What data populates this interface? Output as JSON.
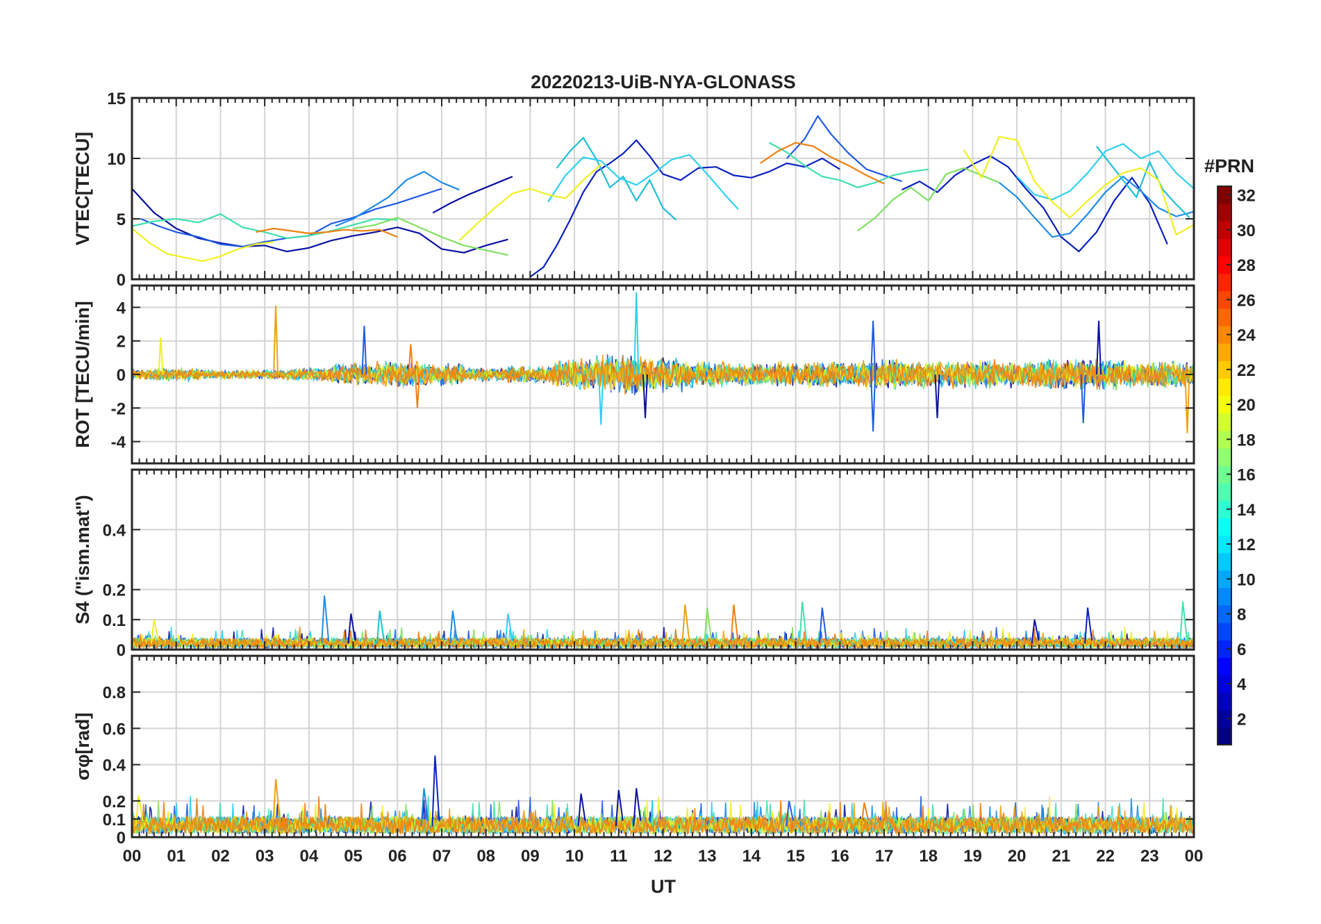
{
  "chart_data": {
    "type": "line",
    "title": "20220213-UiB-NYA-GLONASS",
    "xlabel": "UT",
    "x_ticks": [
      "00",
      "01",
      "02",
      "03",
      "04",
      "05",
      "06",
      "07",
      "08",
      "09",
      "10",
      "11",
      "12",
      "13",
      "14",
      "15",
      "16",
      "17",
      "18",
      "19",
      "20",
      "21",
      "22",
      "23",
      "00"
    ],
    "xlim": [
      0,
      24
    ],
    "grid": true,
    "colorbar": {
      "label": "#PRN",
      "colormap": "jet",
      "range": [
        1,
        32
      ],
      "ticks": [
        2,
        4,
        6,
        8,
        10,
        12,
        14,
        16,
        18,
        20,
        22,
        24,
        26,
        28,
        30,
        32
      ]
    },
    "panels": [
      {
        "id": "vtec",
        "ylabel": "VTEC[TECU]",
        "ylim": [
          0,
          15
        ],
        "y_ticks": [
          0,
          5,
          10,
          15
        ],
        "series": [
          {
            "color": "#0a10a0",
            "x": [
              0,
              0.5,
              1,
              1.5,
              2,
              2.5,
              3,
              3.5,
              4,
              4.5,
              5,
              5.5,
              6,
              6.5,
              7,
              7.5,
              8,
              8.5
            ],
            "y": [
              7.5,
              5.5,
              4.2,
              3.4,
              3.0,
              2.7,
              2.8,
              2.3,
              2.6,
              3.2,
              3.6,
              3.9,
              4.3,
              3.8,
              2.5,
              2.2,
              2.8,
              3.3
            ]
          },
          {
            "color": "#0a10a0",
            "x": [
              6.8,
              7.2,
              7.6,
              8.0,
              8.4,
              8.6
            ],
            "y": [
              5.5,
              6.3,
              7.0,
              7.6,
              8.2,
              8.5
            ]
          },
          {
            "color": "#0a20c0",
            "x": [
              9.0,
              9.3,
              9.6,
              9.9,
              10.2,
              10.5,
              10.8,
              11.1,
              11.4,
              11.7,
              12.0,
              12.4,
              12.8,
              13.2,
              13.6,
              14.0,
              14.4,
              14.8,
              15.2,
              15.6,
              16.0
            ],
            "y": [
              0.2,
              1.0,
              2.8,
              4.9,
              7.2,
              8.9,
              9.6,
              10.4,
              11.5,
              10.2,
              8.7,
              8.2,
              9.2,
              9.3,
              8.6,
              8.4,
              8.9,
              9.6,
              9.3,
              10.0,
              9.1
            ]
          },
          {
            "color": "#0a20c0",
            "x": [
              17.4,
              17.8,
              18.2,
              18.6,
              19.0,
              19.4,
              19.8,
              20.2,
              20.6,
              21.0,
              21.4,
              21.8,
              22.2,
              22.6,
              23.0,
              23.4
            ],
            "y": [
              7.4,
              8.1,
              7.2,
              8.6,
              9.5,
              10.2,
              9.3,
              7.5,
              5.9,
              3.5,
              2.3,
              3.9,
              6.5,
              8.4,
              6.3,
              2.9
            ]
          },
          {
            "color": "#1e5ae6",
            "x": [
              0.2,
              0.6,
              1.0,
              1.5,
              2.0,
              2.5,
              3.0,
              3.5,
              4.0,
              4.5,
              5.0,
              5.5,
              6.0,
              6.5,
              7.0
            ],
            "y": [
              5.0,
              4.4,
              3.9,
              3.5,
              2.9,
              2.7,
              3.1,
              3.4,
              3.6,
              4.6,
              5.1,
              5.8,
              6.3,
              6.9,
              7.5
            ]
          },
          {
            "color": "#1e5ae6",
            "x": [
              14.8,
              15.2,
              15.5,
              15.8,
              16.2,
              16.6,
              17.0,
              17.4
            ],
            "y": [
              10.0,
              11.6,
              13.5,
              12.0,
              10.4,
              9.1,
              8.6,
              8.1
            ]
          },
          {
            "color": "#1e8ce6",
            "x": [
              4.6,
              5.0,
              5.4,
              5.8,
              6.2,
              6.6,
              7.0,
              7.4
            ],
            "y": [
              4.4,
              5.0,
              5.9,
              6.8,
              8.2,
              8.9,
              8.0,
              7.4
            ]
          },
          {
            "color": "#1e8ce6",
            "x": [
              19.6,
              20.0,
              20.4,
              20.8,
              21.2,
              21.6,
              22.0,
              22.4,
              22.8,
              23.2,
              23.6,
              24.0
            ],
            "y": [
              8.0,
              6.8,
              5.1,
              3.5,
              3.8,
              5.4,
              7.2,
              8.5,
              7.3,
              5.9,
              5.2,
              5.6
            ]
          },
          {
            "color": "#1ebed6",
            "x": [
              9.6,
              9.9,
              10.2,
              10.5,
              10.8,
              11.1,
              11.4,
              11.7,
              12.0,
              12.3
            ],
            "y": [
              9.2,
              10.6,
              11.7,
              9.9,
              7.6,
              8.5,
              6.5,
              8.2,
              5.9,
              4.9
            ]
          },
          {
            "color": "#1ebed6",
            "x": [
              21.8,
              22.1,
              22.4,
              22.7,
              23.0,
              23.3,
              23.6,
              23.9
            ],
            "y": [
              11.0,
              9.6,
              8.2,
              6.8,
              9.7,
              7.4,
              6.2,
              5.1
            ]
          },
          {
            "color": "#2ed0f0",
            "x": [
              9.4,
              9.8,
              10.2,
              10.6,
              11.0,
              11.4,
              11.8,
              12.2,
              12.6,
              13.0,
              13.4,
              13.7
            ],
            "y": [
              6.4,
              8.6,
              10.1,
              9.8,
              8.4,
              7.8,
              8.8,
              9.9,
              10.3,
              8.7,
              7.0,
              5.8
            ]
          },
          {
            "color": "#2ed0f0",
            "x": [
              20.0,
              20.4,
              20.8,
              21.2,
              21.6,
              22.0,
              22.4,
              22.8,
              23.2,
              23.6,
              24.0
            ],
            "y": [
              8.5,
              7.0,
              6.6,
              7.3,
              8.8,
              10.6,
              11.2,
              10.0,
              10.6,
              8.8,
              7.5
            ]
          },
          {
            "color": "#40e0b0",
            "x": [
              0.0,
              0.5,
              1.0,
              1.5,
              2.0,
              2.5,
              3.0,
              3.5,
              4.0,
              4.5,
              5.0,
              5.5,
              6.0
            ],
            "y": [
              4.4,
              4.8,
              5.0,
              4.7,
              5.4,
              4.3,
              3.9,
              3.4,
              3.6,
              4.0,
              4.5,
              5.0,
              4.9
            ]
          },
          {
            "color": "#40e0b0",
            "x": [
              14.4,
              14.8,
              15.2,
              15.6,
              16.0,
              16.4,
              16.8,
              17.2,
              17.6,
              18.0
            ],
            "y": [
              11.3,
              10.5,
              9.4,
              8.5,
              8.2,
              7.6,
              8.0,
              8.6,
              8.9,
              9.1
            ]
          },
          {
            "color": "#80e060",
            "x": [
              5.0,
              5.5,
              6.0,
              6.5,
              7.0,
              7.5,
              8.0,
              8.5
            ],
            "y": [
              4.2,
              4.5,
              5.1,
              4.3,
              3.5,
              2.8,
              2.4,
              2.0
            ]
          },
          {
            "color": "#80e060",
            "x": [
              16.4,
              16.8,
              17.2,
              17.6,
              18.0,
              18.4,
              18.8,
              19.2,
              19.6
            ],
            "y": [
              4.0,
              5.1,
              6.6,
              7.6,
              6.5,
              8.7,
              9.2,
              8.6,
              8.0
            ]
          },
          {
            "color": "#f0f020",
            "x": [
              0.0,
              0.4,
              0.8,
              1.2,
              1.6,
              2.0,
              2.4,
              2.8,
              3.2
            ],
            "y": [
              4.2,
              3.0,
              2.1,
              1.8,
              1.5,
              1.9,
              2.5,
              2.9,
              3.1
            ]
          },
          {
            "color": "#f0f020",
            "x": [
              7.4,
              7.8,
              8.2,
              8.6,
              9.0,
              9.4,
              9.8,
              10.2,
              10.6
            ],
            "y": [
              3.2,
              4.6,
              5.9,
              7.1,
              7.5,
              7.0,
              6.7,
              8.2,
              9.5
            ]
          },
          {
            "color": "#f0f020",
            "x": [
              18.8,
              19.2,
              19.6,
              20.0,
              20.4,
              20.8,
              21.2,
              21.6,
              22.0,
              22.4,
              22.8,
              23.2,
              23.6,
              24.0
            ],
            "y": [
              10.7,
              8.4,
              11.8,
              11.5,
              8.1,
              6.4,
              5.1,
              6.5,
              7.8,
              8.8,
              9.2,
              8.2,
              3.7,
              4.5
            ]
          },
          {
            "color": "#f08010",
            "x": [
              2.8,
              3.2,
              3.6,
              4.0,
              4.4,
              4.8,
              5.2,
              5.6,
              6.0
            ],
            "y": [
              3.9,
              4.2,
              4.0,
              3.8,
              3.9,
              4.1,
              4.0,
              4.1,
              3.5
            ]
          },
          {
            "color": "#f08010",
            "x": [
              14.2,
              14.6,
              15.0,
              15.4,
              15.8,
              16.2,
              16.6,
              17.0
            ],
            "y": [
              9.6,
              10.6,
              11.3,
              11.0,
              10.1,
              9.4,
              8.6,
              7.9
            ]
          }
        ]
      },
      {
        "id": "rot",
        "ylabel": "ROT [TECU/min]",
        "ylim": [
          -5.3,
          5.3
        ],
        "y_ticks": [
          -4,
          -2,
          0,
          2,
          4
        ],
        "noise": {
          "amplitude_by_hour": [
            0.25,
            0.3,
            0.2,
            0.2,
            0.3,
            0.5,
            0.6,
            0.5,
            0.3,
            0.4,
            0.7,
            1.0,
            0.8,
            0.6,
            0.5,
            0.6,
            0.6,
            0.7,
            0.6,
            0.7,
            0.6,
            0.7,
            0.7,
            0.6,
            0.6
          ]
        },
        "spikes": [
          {
            "x": 0.65,
            "y": 2.2,
            "color": "#f0f020"
          },
          {
            "x": 3.25,
            "y": 4.1,
            "color": "#f0a010"
          },
          {
            "x": 5.25,
            "y": 2.9,
            "color": "#1e5ae6"
          },
          {
            "x": 6.3,
            "y": 1.8,
            "color": "#f08010"
          },
          {
            "x": 6.45,
            "y": -2.0,
            "color": "#f08010"
          },
          {
            "x": 10.6,
            "y": -3.0,
            "color": "#2ed0f0"
          },
          {
            "x": 11.4,
            "y": 4.9,
            "color": "#2ed0f0"
          },
          {
            "x": 11.6,
            "y": -2.6,
            "color": "#0a10a0"
          },
          {
            "x": 16.75,
            "y": 3.2,
            "color": "#1e5ae6"
          },
          {
            "x": 16.75,
            "y": -3.4,
            "color": "#1e5ae6"
          },
          {
            "x": 18.2,
            "y": -2.6,
            "color": "#0a10a0"
          },
          {
            "x": 21.5,
            "y": -2.9,
            "color": "#1e5ae6"
          },
          {
            "x": 21.85,
            "y": 3.2,
            "color": "#0a10a0"
          },
          {
            "x": 23.85,
            "y": -3.5,
            "color": "#f0a010"
          }
        ]
      },
      {
        "id": "s4",
        "ylabel": "S4 (\"ism.mat\")",
        "ylim": [
          0,
          0.6
        ],
        "y_ticks": [
          0,
          0.1,
          0.2,
          0.4
        ],
        "baseline": 0.02,
        "spikes": [
          {
            "x": 0.5,
            "y": 0.1,
            "color": "#f0f020"
          },
          {
            "x": 4.35,
            "y": 0.18,
            "color": "#1e8ce6"
          },
          {
            "x": 4.95,
            "y": 0.12,
            "color": "#0a10a0"
          },
          {
            "x": 5.6,
            "y": 0.13,
            "color": "#1ebed6"
          },
          {
            "x": 7.25,
            "y": 0.13,
            "color": "#1e8ce6"
          },
          {
            "x": 8.5,
            "y": 0.12,
            "color": "#2ed0f0"
          },
          {
            "x": 12.5,
            "y": 0.15,
            "color": "#f0a010"
          },
          {
            "x": 13.0,
            "y": 0.14,
            "color": "#80e060"
          },
          {
            "x": 13.6,
            "y": 0.15,
            "color": "#f08010"
          },
          {
            "x": 15.15,
            "y": 0.16,
            "color": "#40e0b0"
          },
          {
            "x": 15.6,
            "y": 0.14,
            "color": "#1e5ae6"
          },
          {
            "x": 20.4,
            "y": 0.1,
            "color": "#0a10a0"
          },
          {
            "x": 21.6,
            "y": 0.14,
            "color": "#0a20c0"
          },
          {
            "x": 23.75,
            "y": 0.16,
            "color": "#40e0b0"
          }
        ]
      },
      {
        "id": "sigma_phi",
        "ylabel": "σφ[rad]",
        "ylim": [
          0,
          1
        ],
        "y_ticks": [
          0,
          0.1,
          0.2,
          0.4,
          0.6,
          0.8
        ],
        "baseline": 0.06,
        "spikes": [
          {
            "x": 0.15,
            "y": 0.23,
            "color": "#f0f020"
          },
          {
            "x": 3.25,
            "y": 0.32,
            "color": "#f0a010"
          },
          {
            "x": 6.6,
            "y": 0.27,
            "color": "#1e8ce6"
          },
          {
            "x": 6.85,
            "y": 0.45,
            "color": "#0a20c0"
          },
          {
            "x": 10.15,
            "y": 0.24,
            "color": "#0a10a0"
          },
          {
            "x": 11.0,
            "y": 0.26,
            "color": "#0a10a0"
          },
          {
            "x": 11.4,
            "y": 0.27,
            "color": "#0a10a0"
          },
          {
            "x": 14.85,
            "y": 0.2,
            "color": "#1e5ae6"
          },
          {
            "x": 16.55,
            "y": 0.19,
            "color": "#f08010"
          }
        ]
      }
    ]
  }
}
